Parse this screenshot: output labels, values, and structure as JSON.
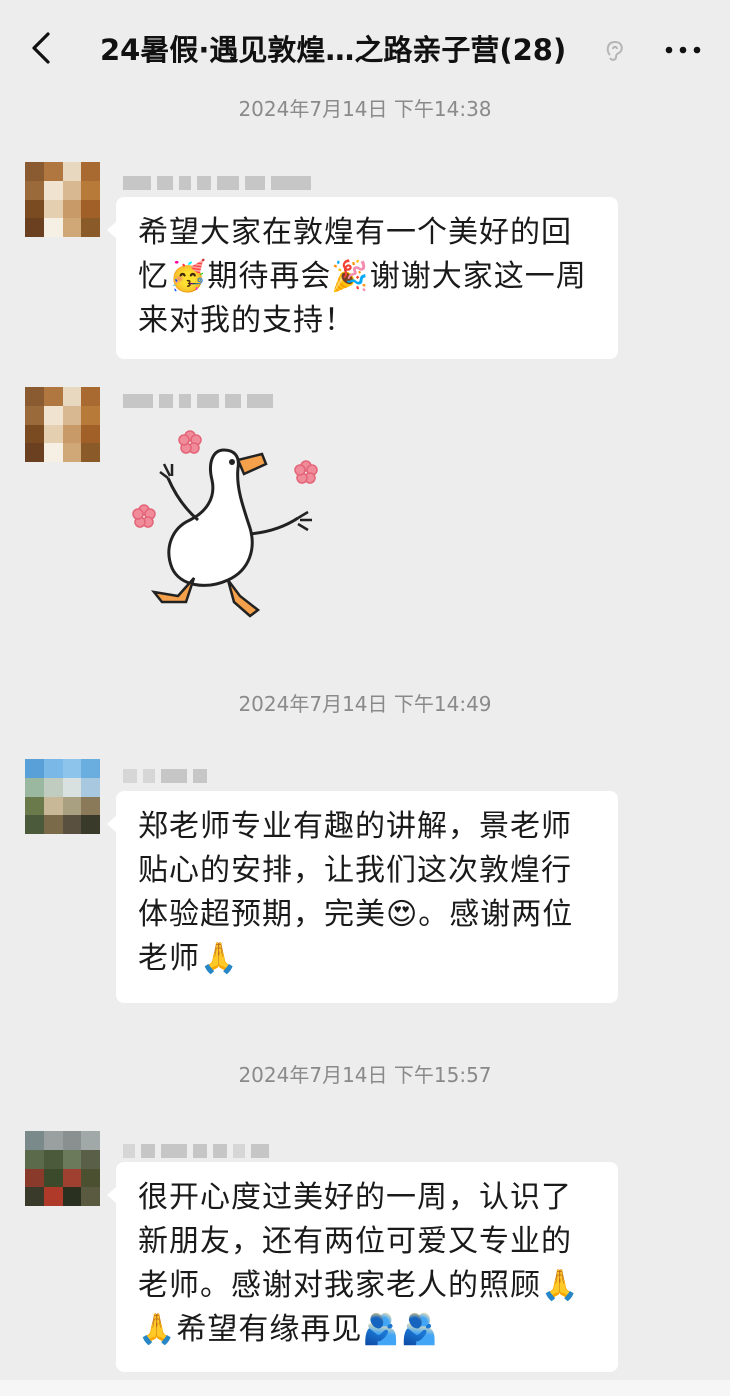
{
  "header": {
    "title": "24暑假·遇见敦煌…之路亲子营(28)",
    "back_icon": "chevron-left-icon",
    "mute_icon": "ear-muted-icon",
    "more_icon": "ellipsis-icon"
  },
  "timestamps": [
    "2024年7月14日 下午14:38",
    "2024年7月14日 下午14:49",
    "2024年7月14日 下午15:57"
  ],
  "messages": [
    {
      "text": "希望大家在敦煌有一个美好的回忆🥳期待再会🎉谢谢大家这一周来对我的支持！"
    },
    {
      "sticker": "dancing-goose-sticker"
    },
    {
      "text": "郑老师专业有趣的讲解，景老师贴心的安排，让我们这次敦煌行体验超预期，完美😍。感谢两位老师🙏"
    },
    {
      "text": "很开心度过美好的一周，认识了新朋友，还有两位可爱又专业的老师。感谢对我家老人的照顾🙏🙏希望有缘再见🫂🫂"
    }
  ],
  "colors": {
    "background": "#ededed",
    "bubble": "#ffffff",
    "timestamp": "#8a8a8a"
  }
}
